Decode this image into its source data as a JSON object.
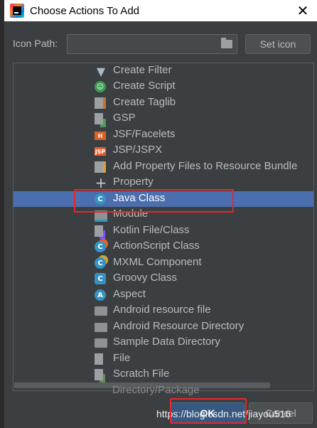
{
  "window": {
    "title": "Choose Actions To Add",
    "close_glyph": "✕"
  },
  "icon_path": {
    "label": "Icon Path:",
    "value": "",
    "set_icon_label": "Set icon"
  },
  "actions": {
    "selected_index": 8,
    "items": [
      {
        "label": "Create Filter",
        "icon": "filter-icon"
      },
      {
        "label": "Create Script",
        "icon": "script-icon"
      },
      {
        "label": "Create Taglib",
        "icon": "taglib-icon"
      },
      {
        "label": "GSP",
        "icon": "gsp-icon"
      },
      {
        "label": "JSF/Facelets",
        "icon": "html-file-icon"
      },
      {
        "label": "JSP/JSPX",
        "icon": "jsp-file-icon"
      },
      {
        "label": "Add Property Files to Resource Bundle",
        "icon": "properties-icon"
      },
      {
        "label": "Property",
        "icon": "plus-icon"
      },
      {
        "label": "Java Class",
        "icon": "java-class-icon"
      },
      {
        "label": "Module",
        "icon": "module-icon"
      },
      {
        "label": "Kotlin File/Class",
        "icon": "kotlin-file-icon"
      },
      {
        "label": "ActionScript Class",
        "icon": "actionscript-class-icon"
      },
      {
        "label": "MXML Component",
        "icon": "mxml-icon"
      },
      {
        "label": "Groovy Class",
        "icon": "groovy-class-icon"
      },
      {
        "label": "Aspect",
        "icon": "aspect-icon"
      },
      {
        "label": "Android resource file",
        "icon": "folder-icon"
      },
      {
        "label": "Android Resource Directory",
        "icon": "folder-icon"
      },
      {
        "label": "Sample Data Directory",
        "icon": "folder-icon"
      },
      {
        "label": "File",
        "icon": "file-icon"
      },
      {
        "label": "Scratch File",
        "icon": "scratch-file-icon"
      }
    ],
    "partial_last": "Directory/Package"
  },
  "buttons": {
    "ok": "OK",
    "cancel": "Cancel"
  },
  "watermark": "https://blog.csdn.net/jiayou516",
  "colors": {
    "background": "#3c3f41",
    "selection": "#4b6eaf",
    "text": "#bbbbbb",
    "highlight_box": "#e8262e",
    "ok_button": "#365880"
  }
}
